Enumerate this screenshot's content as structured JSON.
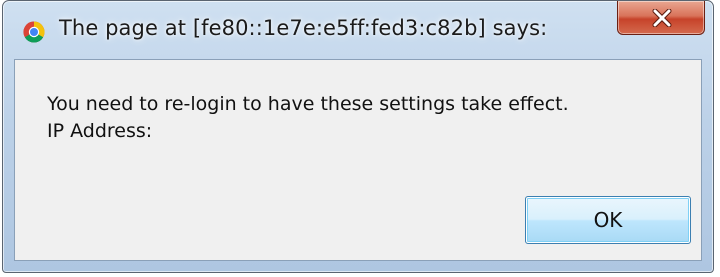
{
  "dialog": {
    "title": "The page at [fe80::1e7e:e5ff:fed3:c82b] says:",
    "app_icon": "chrome-icon",
    "close_icon": "close-icon",
    "message_lines": [
      "You need to re-login to have these settings take effect.",
      "IP Address:"
    ],
    "ok_label": "OK"
  },
  "colors": {
    "frame": "#bcd1e8",
    "client_background": "#f0f0f0",
    "close_button": "#c7432a",
    "ok_button_border": "#3c7fb1"
  }
}
